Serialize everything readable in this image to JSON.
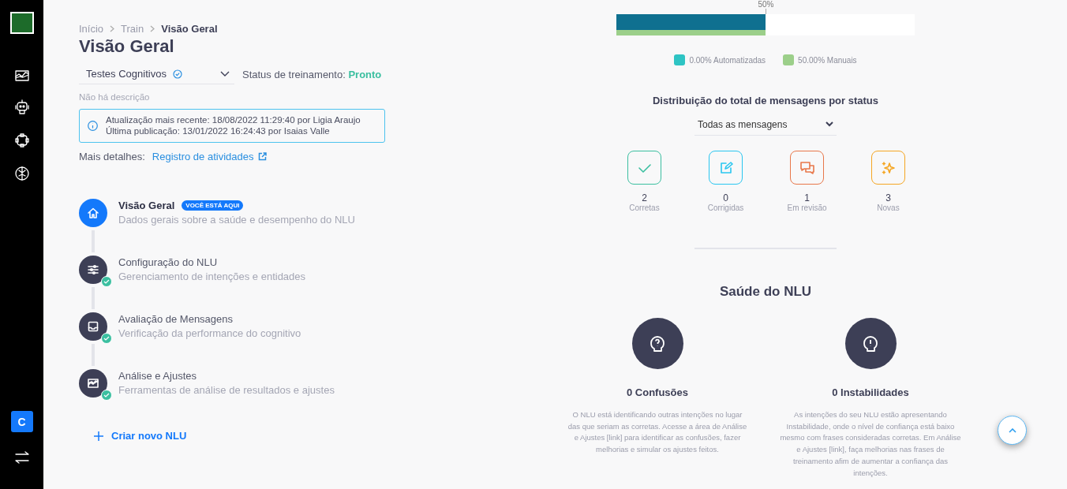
{
  "sidebar": {
    "avatar_letter": "C"
  },
  "breadcrumb": [
    {
      "label": "Início",
      "selected": false
    },
    {
      "label": "Train",
      "selected": false
    },
    {
      "label": "Visão Geral",
      "selected": true
    }
  ],
  "page_title": "Visão Geral",
  "nlu_select": {
    "value": "Testes Cognitivos",
    "verified": true
  },
  "training_status": {
    "label": "Status de treinamento:",
    "value": "Pronto"
  },
  "description": "Não há descrição",
  "info_box": {
    "lines": [
      "Atualização mais recente: 18/08/2022 11:29:40 por Ligia Araujo",
      "Última publicação: 13/01/2022 16:24:43 por Isaias Valle"
    ]
  },
  "more_details": {
    "label": "Mais detalhes:",
    "link": "Registro de atividades"
  },
  "steps": [
    {
      "kind": "home",
      "title": "Visão Geral",
      "subtitle": "Dados gerais sobre a saúde e desempenho do NLU",
      "selected": true,
      "done": false,
      "badge": "VOCÊ ESTÁ AQUI"
    },
    {
      "kind": "sliders",
      "title": "Configuração do NLU",
      "subtitle": "Gerenciamento de intenções e entidades",
      "selected": false,
      "done": true
    },
    {
      "kind": "inbox",
      "title": "Avaliação de Mensagens",
      "subtitle": "Verificação da performance do cognitivo",
      "selected": false,
      "done": true
    },
    {
      "kind": "chart",
      "title": "Análise e Ajustes",
      "subtitle": "Ferramentas de análise de resultados e ajustes",
      "selected": false,
      "done": true
    }
  ],
  "create_button": "Criar novo NLU",
  "automation": {
    "marker": "50%",
    "bars": [
      {
        "level": 0.5,
        "color": "#0f7090"
      },
      {
        "level": 0.5,
        "color": "#9ccf8a"
      }
    ],
    "legend": [
      {
        "label": "0.00% Automatizadas",
        "color": "#2ec4c4"
      },
      {
        "label": "50.00% Manuais",
        "color": "#9ccf8a"
      }
    ]
  },
  "distribution": {
    "title": "Distribuição do total de mensagens por status",
    "filter": "Todas as mensagens",
    "statuses": [
      {
        "kind": "correct",
        "count": "2",
        "label": "Corretas",
        "color": "#3bbfa0"
      },
      {
        "kind": "corrected",
        "count": "0",
        "label": "Corrigidas",
        "color": "#29c6f0"
      },
      {
        "kind": "review",
        "count": "1",
        "label": "Em revisão",
        "color": "#e8774a"
      },
      {
        "kind": "new",
        "count": "3",
        "label": "Novas",
        "color": "#f5a623"
      }
    ]
  },
  "health": {
    "title": "Saúde do NLU",
    "cards": [
      {
        "kind": "confusion",
        "title": "0 Confusões",
        "text": "O NLU está identificando outras intenções no lugar das que seriam as corretas. Acesse a área de Análise e Ajustes [link] para identificar as confusões, fazer melhorias e simular os ajustes feitos."
      },
      {
        "kind": "instability",
        "title": "0 Instabilidades",
        "text": "As intenções do seu NLU estão apresentando Instabilidade, onde o nível de confiança está baixo mesmo com frases consideradas corretas. Em Análise e Ajustes [link], faça melhorias nas frases de treinamento afim de aumentar a confiança das intenções."
      }
    ]
  }
}
